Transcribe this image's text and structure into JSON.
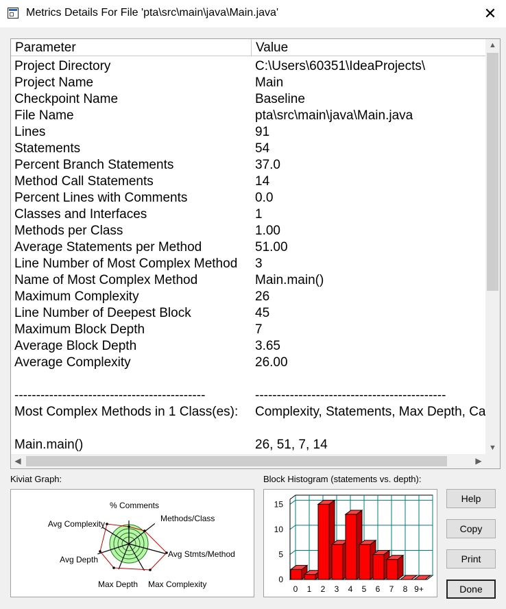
{
  "window": {
    "title": "Metrics Details For File 'pta\\src\\main\\java\\Main.java'",
    "close_glyph": "✕"
  },
  "table": {
    "headers": [
      "Parameter",
      "Value"
    ],
    "rows": [
      [
        "Project Directory",
        "C:\\Users\\60351\\IdeaProjects\\"
      ],
      [
        "Project Name",
        "Main"
      ],
      [
        "Checkpoint Name",
        "Baseline"
      ],
      [
        "File Name",
        "pta\\src\\main\\java\\Main.java"
      ],
      [
        "Lines",
        "91"
      ],
      [
        "Statements",
        "54"
      ],
      [
        "Percent Branch Statements",
        "37.0"
      ],
      [
        "Method Call Statements",
        "14"
      ],
      [
        "Percent Lines with Comments",
        "0.0"
      ],
      [
        "Classes and Interfaces",
        "1"
      ],
      [
        "Methods per Class",
        "1.00"
      ],
      [
        "Average Statements per Method",
        "51.00"
      ],
      [
        "Line Number of Most Complex Method",
        "3"
      ],
      [
        "Name of Most Complex Method",
        "Main.main()"
      ],
      [
        "Maximum Complexity",
        "26"
      ],
      [
        "Line Number of Deepest Block",
        "45"
      ],
      [
        "Maximum Block Depth",
        "7"
      ],
      [
        "Average Block Depth",
        "3.65"
      ],
      [
        "Average Complexity",
        "26.00"
      ],
      [
        "",
        ""
      ],
      [
        "--------------------------------------------",
        "--------------------------------------------"
      ],
      [
        "Most Complex Methods in 1 Class(es):",
        "Complexity, Statements, Max Depth, Calls"
      ],
      [
        "",
        ""
      ],
      [
        "Main.main()",
        "26, 51, 7, 14"
      ]
    ]
  },
  "kiviat": {
    "label": "Kiviat Graph:",
    "axes": [
      "% Comments",
      "Methods/Class",
      "Avg Stmts/Method",
      "Max Complexity",
      "Max Depth",
      "Avg Depth",
      "Avg Complexity"
    ]
  },
  "histogram": {
    "label": "Block Histogram (statements vs. depth):",
    "y_ticks": [
      "0",
      "5",
      "10",
      "15"
    ],
    "x_ticks": [
      "0",
      "1",
      "2",
      "3",
      "4",
      "5",
      "6",
      "7",
      "8",
      "9+"
    ]
  },
  "chart_data": {
    "type": "bar",
    "title": "Block Histogram (statements vs. depth):",
    "categories": [
      "0",
      "1",
      "2",
      "3",
      "4",
      "5",
      "6",
      "7",
      "8",
      "9+"
    ],
    "values": [
      2,
      1,
      15,
      7,
      13,
      7,
      5,
      4,
      0,
      0
    ],
    "ylim": [
      0,
      16
    ],
    "grid": true,
    "bar_color": "#ff0000"
  },
  "buttons": {
    "help": "Help",
    "copy": "Copy",
    "print": "Print",
    "done": "Done"
  },
  "colors": {
    "bar": "#ff0000",
    "kiviat_fill": "#b8f5a8",
    "kiviat_polygon": "#cc0000"
  }
}
